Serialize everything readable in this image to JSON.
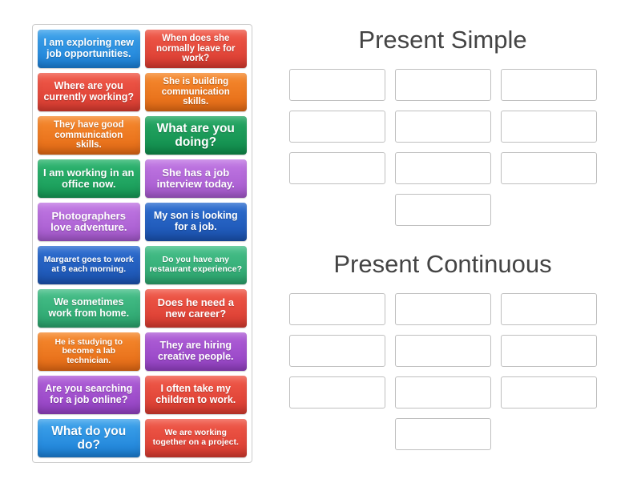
{
  "sections": {
    "simple": {
      "title": "Present Simple",
      "slots": 10
    },
    "continuous": {
      "title": "Present Continuous",
      "slots": 10
    }
  },
  "cards": [
    {
      "text": "I am exploring new job opportunities.",
      "color": "blue",
      "size": "fs-12"
    },
    {
      "text": "When does she normally leave for work?",
      "color": "red",
      "size": "fs-11"
    },
    {
      "text": "Where are you currently working?",
      "color": "red",
      "size": "fs-12"
    },
    {
      "text": "She is building communication skills.",
      "color": "orange",
      "size": "fs-11"
    },
    {
      "text": "They have good communication skills.",
      "color": "orange",
      "size": "fs-11"
    },
    {
      "text": "What are you doing?",
      "color": "greenD",
      "size": "fs-15"
    },
    {
      "text": "I am working in an office now.",
      "color": "green",
      "size": "fs-13"
    },
    {
      "text": "She has a job interview today.",
      "color": "purpleL",
      "size": "fs-13"
    },
    {
      "text": "Photographers love adventure.",
      "color": "purpleL",
      "size": "fs-13"
    },
    {
      "text": "My son is looking for a job.",
      "color": "blueD",
      "size": "fs-12"
    },
    {
      "text": "Margaret goes to work at 8 each morning.",
      "color": "blueD",
      "size": "fs-10"
    },
    {
      "text": "Do you have any restaurant experience?",
      "color": "greenL",
      "size": "fs-10"
    },
    {
      "text": "We sometimes work from home.",
      "color": "greenL",
      "size": "fs-12"
    },
    {
      "text": "Does he need a new career?",
      "color": "red",
      "size": "fs-13"
    },
    {
      "text": "He is studying to become a lab technician.",
      "color": "orange",
      "size": "fs-10"
    },
    {
      "text": "They are hiring creative people.",
      "color": "purple",
      "size": "fs-12"
    },
    {
      "text": "Are you searching for a job online?",
      "color": "purple",
      "size": "fs-12"
    },
    {
      "text": "I often take my children to work.",
      "color": "red",
      "size": "fs-12"
    },
    {
      "text": "What do you do?",
      "color": "blue",
      "size": "fs-15"
    },
    {
      "text": "We are working together on a project.",
      "color": "red",
      "size": "fs-10"
    }
  ]
}
